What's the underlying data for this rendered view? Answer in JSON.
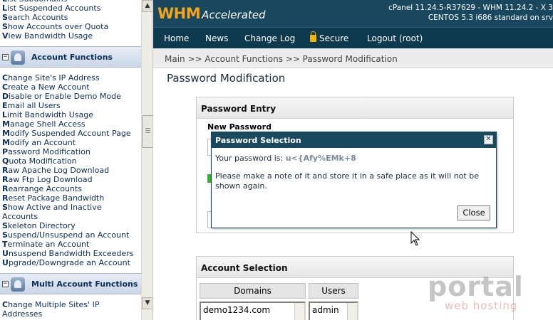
{
  "sidebar": {
    "top_links": [
      {
        "first": "L",
        "rest": "ist Subdomains"
      },
      {
        "first": "L",
        "rest": "ist Suspended Accounts"
      },
      {
        "first": "S",
        "rest": "earch Accounts"
      },
      {
        "first": "S",
        "rest": "how Accounts over Quota"
      },
      {
        "first": "V",
        "rest": "iew Bandwidth Usage"
      }
    ],
    "account_functions": {
      "title": "Account Functions",
      "links": [
        {
          "first": "C",
          "rest": "hange Site's IP Address"
        },
        {
          "first": "C",
          "rest": "reate a New Account"
        },
        {
          "first": "D",
          "rest": "isable or Enable Demo Mode"
        },
        {
          "first": "E",
          "rest": "mail all Users"
        },
        {
          "first": "L",
          "rest": "imit Bandwidth Usage"
        },
        {
          "first": "M",
          "rest": "anage Shell Access"
        },
        {
          "first": "M",
          "rest": "odify Suspended Account Page"
        },
        {
          "first": "M",
          "rest": "odify an Account"
        },
        {
          "first": "P",
          "rest": "assword Modification"
        },
        {
          "first": "Q",
          "rest": "uota Modification"
        },
        {
          "first": "R",
          "rest": "aw Apache Log Download"
        },
        {
          "first": "R",
          "rest": "aw Ftp Log Download"
        },
        {
          "first": "R",
          "rest": "earrange Accounts"
        },
        {
          "first": "R",
          "rest": "eset Package Bandwidth"
        },
        {
          "first": "S",
          "rest": "how Active and Inactive"
        },
        {
          "first": "",
          "rest": "Accounts"
        },
        {
          "first": "S",
          "rest": "keleton Directory"
        },
        {
          "first": "S",
          "rest": "uspend/Unsuspend an Account"
        },
        {
          "first": "T",
          "rest": "erminate an Account"
        },
        {
          "first": "U",
          "rest": "nsuspend Bandwidth Exceeders"
        },
        {
          "first": "U",
          "rest": "pgrade/Downgrade an Account"
        }
      ]
    },
    "multi_account_functions": {
      "title": "Multi Account Functions",
      "links": [
        {
          "first": "C",
          "rest": "hange Multiple Sites' IP"
        },
        {
          "first": "",
          "rest": "Addresses"
        }
      ]
    }
  },
  "header": {
    "logo_whm": "WHM",
    "logo_accelerated": "Accelerated",
    "server_line1": "cPanel 11.24.5-R37629 - WHM 11.24.2 - X 3",
    "server_line2": "CENTOS 5.3 i686 standard on srv"
  },
  "navbar": {
    "home": "Home",
    "news": "News",
    "change_log": "Change Log",
    "secure": "Secure",
    "logout": "Logout (root)"
  },
  "breadcrumb": "Main >> Account Functions >> Password Modification",
  "page_title": "Password Modification",
  "password_entry": {
    "title": "Password Entry",
    "new_password_label": "New Password"
  },
  "account_selection": {
    "title": "Account Selection",
    "domains_header": "Domains",
    "users_header": "Users",
    "domain_item": "demo1234.com",
    "user_item": "admin"
  },
  "dialog": {
    "title": "Password Selection",
    "close_icon": "close-icon",
    "password_prefix": "Your password is:",
    "password_value": "u<{Afy%EMk+8",
    "note": "Please make a note of it and store it in a safe place as it will not be shown again.",
    "close_button": "Close"
  },
  "watermark": {
    "main": "portal",
    "sub": "web hosting"
  },
  "colors": {
    "banner": "#19475d",
    "navbar": "#0d3a4e",
    "logo_accent": "#f5a41c",
    "link": "#0b2f5a",
    "dialog_header": "#18495f"
  }
}
